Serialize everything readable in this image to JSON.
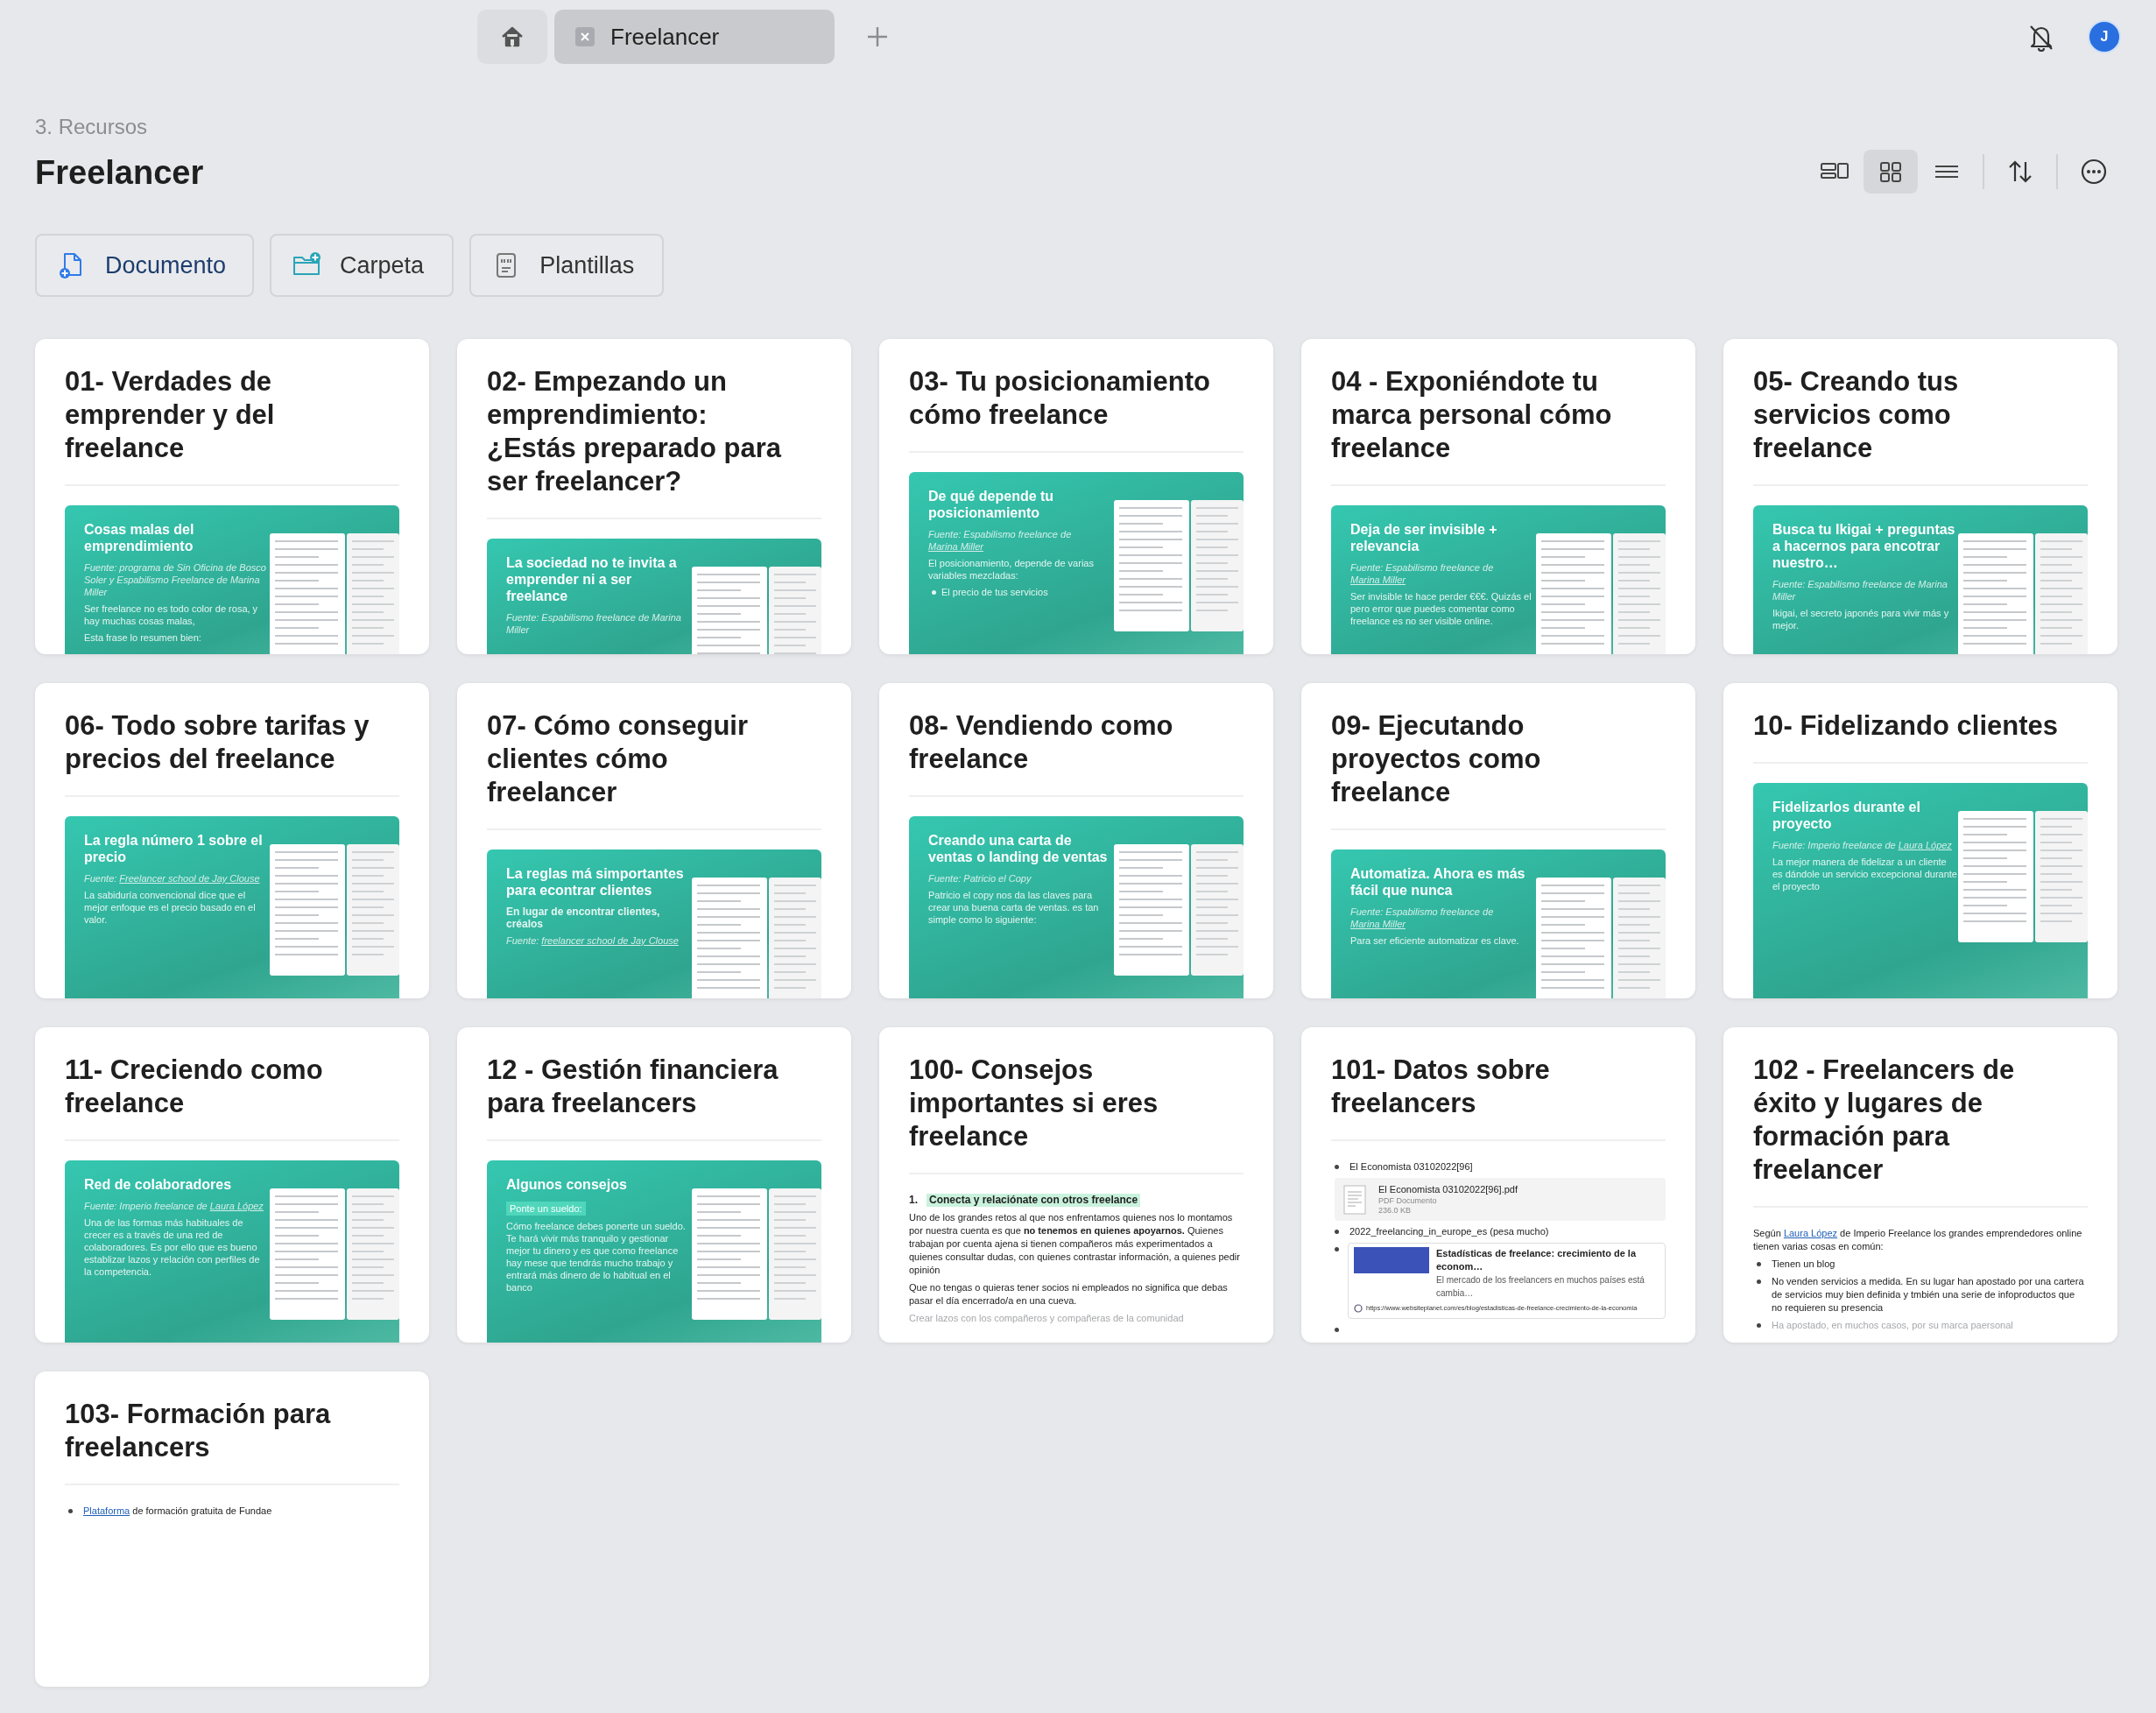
{
  "top_bar": {
    "tabs": [
      {
        "kind": "home",
        "selected": false
      },
      {
        "kind": "page",
        "label": "Freelancer",
        "selected": true
      }
    ],
    "avatar": "J"
  },
  "header": {
    "breadcrumb": "3. Recursos",
    "title": "Freelancer",
    "view_modes": [
      {
        "kind": "gallery",
        "selected": false
      },
      {
        "kind": "grid",
        "selected": true
      },
      {
        "kind": "list",
        "selected": false
      }
    ]
  },
  "new_buttons": [
    {
      "kind": "document",
      "label": "Documento"
    },
    {
      "kind": "folder",
      "label": "Carpeta"
    },
    {
      "kind": "template",
      "label": "Plantillas"
    }
  ],
  "cards": [
    {
      "title": "01- Verdades de emprender y del freelance",
      "preview": {
        "kind": "banner",
        "heading": "Cosas malas del emprendimiento",
        "lines": [
          {
            "kind": "source",
            "parts": [
              {
                "text": "Fuente: programa de Sin Oficina de Bosco Soler y Espabilismo Freelance de Marina Miller"
              }
            ]
          },
          {
            "kind": "body",
            "parts": [
              {
                "text": "Ser freelance no es todo color de rosa, y hay muchas cosas malas,"
              }
            ]
          },
          {
            "kind": "body",
            "parts": [
              {
                "text": "Esta frase lo resumen bien:"
              }
            ]
          }
        ]
      }
    },
    {
      "title": "02- Empezando un emprendimiento: ¿Estás preparado para ser freelancer?",
      "preview": {
        "kind": "banner",
        "heading": "La sociedad no te invita a emprender ni a ser freelance",
        "lines": [
          {
            "kind": "source",
            "parts": [
              {
                "text": "Fuente: Espabilismo freelance de Marina Miller"
              }
            ]
          }
        ]
      }
    },
    {
      "title": "03- Tu posicionamiento cómo freelance",
      "preview": {
        "kind": "banner",
        "heading": "De qué depende tu posicionamiento",
        "lines": [
          {
            "kind": "source",
            "parts": [
              {
                "text": "Fuente: Espabilismo freelance de "
              },
              {
                "text": "Marina Miller",
                "link": true
              }
            ]
          },
          {
            "kind": "body",
            "parts": [
              {
                "text": "El posicionamiento, depende de varias variables mezcladas:"
              }
            ]
          },
          {
            "kind": "bullet",
            "parts": [
              {
                "text": "El precio de tus servicios"
              }
            ]
          }
        ]
      }
    },
    {
      "title": "04 - Exponiéndote tu marca personal cómo freelance",
      "preview": {
        "kind": "banner",
        "heading": "Deja de ser invisible + relevancia",
        "lines": [
          {
            "kind": "source",
            "parts": [
              {
                "text": "Fuente: Espabilismo freelance de "
              },
              {
                "text": "Marina Miller",
                "link": true
              }
            ]
          },
          {
            "kind": "body",
            "parts": [
              {
                "text": "Ser invisible te hace perder €€€. Quizás el pero error que puedes comentar como freelance es no ser visible online."
              }
            ]
          }
        ]
      }
    },
    {
      "title": "05- Creando tus servicios como freelance",
      "preview": {
        "kind": "banner",
        "heading": "Busca tu Ikigai + preguntas a hacernos para encotrar nuestro…",
        "lines": [
          {
            "kind": "source",
            "parts": [
              {
                "text": "Fuente: Espabilismo freelance de Marina Miller"
              }
            ]
          },
          {
            "kind": "body",
            "parts": [
              {
                "text": "Ikigai, el secreto japonés para vivir más y mejor."
              }
            ]
          }
        ]
      }
    },
    {
      "title": "06- Todo sobre tarifas y precios del freelance",
      "preview": {
        "kind": "banner",
        "heading": "La regla número 1 sobre el precio",
        "lines": [
          {
            "kind": "source",
            "parts": [
              {
                "text": "Fuente: "
              },
              {
                "text": "Freelancer school de Jay Clouse",
                "link": true
              }
            ]
          },
          {
            "kind": "body",
            "parts": [
              {
                "text": "La sabiduría convencional dice que el mejor enfoque es el precio basado en el valor."
              }
            ]
          }
        ]
      }
    },
    {
      "title": "07- Cómo conseguir clientes cómo freelancer",
      "preview": {
        "kind": "banner",
        "heading": "La reglas má simportantes para econtrar clientes",
        "lines": [
          {
            "kind": "subheading",
            "parts": [
              {
                "text": "En lugar de encontrar clientes, créalos"
              }
            ]
          },
          {
            "kind": "source",
            "parts": [
              {
                "text": "Fuente: "
              },
              {
                "text": "freelancer school de Jay Clouse",
                "link": true
              }
            ]
          }
        ]
      }
    },
    {
      "title": "08- Vendiendo como freelance",
      "preview": {
        "kind": "banner",
        "heading": "Creando una carta de ventas o landing de ventas",
        "lines": [
          {
            "kind": "source",
            "parts": [
              {
                "text": "Fuente: Patricio el Copy"
              }
            ]
          },
          {
            "kind": "body",
            "parts": [
              {
                "text": "Patricio el copy nos da las claves para crear una buena carta de ventas. es tan simple como lo siguiente:"
              }
            ]
          }
        ]
      }
    },
    {
      "title": "09- Ejecutando proyectos como freelance",
      "preview": {
        "kind": "banner",
        "heading": "Automatiza. Ahora es más fácil que nunca",
        "lines": [
          {
            "kind": "source",
            "parts": [
              {
                "text": "Fuente: Espabilismo freelance de "
              },
              {
                "text": "Marina Miller",
                "link": true
              }
            ]
          },
          {
            "kind": "body",
            "parts": [
              {
                "text": "Para ser eficiente automatizar es clave."
              }
            ]
          }
        ]
      }
    },
    {
      "title": "10- Fidelizando clientes",
      "preview": {
        "kind": "banner",
        "heading": "Fidelizarlos durante el proyecto",
        "lines": [
          {
            "kind": "source",
            "parts": [
              {
                "text": "Fuente: Imperio freelance de "
              },
              {
                "text": "Laura López",
                "link": true
              }
            ]
          },
          {
            "kind": "body",
            "parts": [
              {
                "text": "La mejor manera de fidelizar a un cliente es dándole un servicio excepcional durante el proyecto"
              }
            ]
          }
        ]
      }
    },
    {
      "title": "11- Creciendo como freelance",
      "preview": {
        "kind": "banner",
        "heading": "Red de colaboradores",
        "lines": [
          {
            "kind": "source",
            "parts": [
              {
                "text": "Fuente: Imperio freelance de "
              },
              {
                "text": "Laura López",
                "link": true
              }
            ]
          },
          {
            "kind": "body",
            "parts": [
              {
                "text": "Una de las formas más habituales de crecer es a través de una red de colaboradores. Es por ello que es bueno establizar lazos y relación con perfiles de la competencia."
              }
            ]
          }
        ]
      }
    },
    {
      "title": "12 - Gestión financiera para freelancers",
      "preview": {
        "kind": "banner",
        "heading": "Algunos consejos",
        "lines": [
          {
            "kind": "tag",
            "parts": [
              {
                "text": "Ponte un sueldo:"
              }
            ]
          },
          {
            "kind": "body",
            "parts": [
              {
                "text": "Cómo freelance debes ponerte un sueldo. Te hará vivir más tranquilo y gestionar mejor tu dinero y es que como freelance hay mese que tendrás mucho trabajo y entrará más dinero de lo habitual en el banco"
              }
            ]
          }
        ]
      }
    },
    {
      "title": "100- Consejos importantes si eres freelance",
      "preview": {
        "kind": "text",
        "lines": [
          {
            "kind": "numbered",
            "number": "1.",
            "parts": [
              {
                "text": "Conecta y relaciónate con otros freelance"
              }
            ]
          },
          {
            "kind": "para",
            "parts": [
              {
                "text": "Uno de los grandes retos al que nos enfrentamos quienes nos lo montamos por nuestra cuenta es que **no tenemos en quienes apoyarnos.** Quienes trabajan por cuenta ajena si tienen compañeros más experimentados a quienes consultar dudas, con quienes contrastar información, a quienes pedir opinión"
              }
            ]
          },
          {
            "kind": "para",
            "parts": [
              {
                "text": "Que no tengas o quieras tener socios ni empleados no significa que debas pasar el día encerrado/a en una cueva."
              }
            ]
          },
          {
            "kind": "faded",
            "parts": [
              {
                "text": "Crear lazos con los compañeros y compañeras de la comunidad"
              }
            ]
          }
        ]
      }
    },
    {
      "title": "101- Datos sobre freelancers",
      "preview": {
        "kind": "text",
        "lines": [
          {
            "kind": "bullet",
            "parts": [
              {
                "text": "El Economista 03102022[96]"
              }
            ]
          },
          {
            "kind": "file",
            "name": "El Economista 03102022[96].pdf",
            "type": "PDF Documento",
            "size": "236.0 KB"
          },
          {
            "kind": "bullet",
            "parts": [
              {
                "text": "2022_freelancing_in_europe_es (pesa mucho)"
              }
            ]
          },
          {
            "kind": "linkcard",
            "title": "Estadísticas de freelance: crecimiento de la econom…",
            "description": "El mercado de los freelancers en muchos países está cambia…",
            "url": "https://www.websiteplanet.com/es/blog/estadisticas-de-freelance-crecimiento-de-la-economia"
          },
          {
            "kind": "bullet"
          }
        ]
      }
    },
    {
      "title": "102 - Freelancers de éxito y lugares de formación para freelancer",
      "preview": {
        "kind": "text",
        "lines": [
          {
            "kind": "para",
            "parts": [
              {
                "text": "Según "
              },
              {
                "text": "Laura López",
                "link": true
              },
              {
                "text": " de Imperio Freelance los grandes emprendedores online tienen varias cosas en común:"
              }
            ]
          },
          {
            "kind": "bullet",
            "parts": [
              {
                "text": "Tienen un blog"
              }
            ]
          },
          {
            "kind": "bullet",
            "parts": [
              {
                "text": "No venden servicios a medida. En su lugar han apostado por una cartera de servicios muy bien definida y tmbién una serie de infoproductos que no requieren su presencia"
              }
            ]
          },
          {
            "kind": "faded-bullet",
            "parts": [
              {
                "text": "Ha apostado, en muchos casos, por su marca paersonal"
              }
            ]
          }
        ]
      }
    },
    {
      "title": "103- Formación para freelancers",
      "preview": {
        "kind": "text",
        "lines": [
          {
            "kind": "bullet",
            "parts": [
              {
                "text": "Plataforma",
                "link": true
              },
              {
                "text": " de formación gratuita de Fundae"
              }
            ]
          }
        ]
      }
    }
  ]
}
